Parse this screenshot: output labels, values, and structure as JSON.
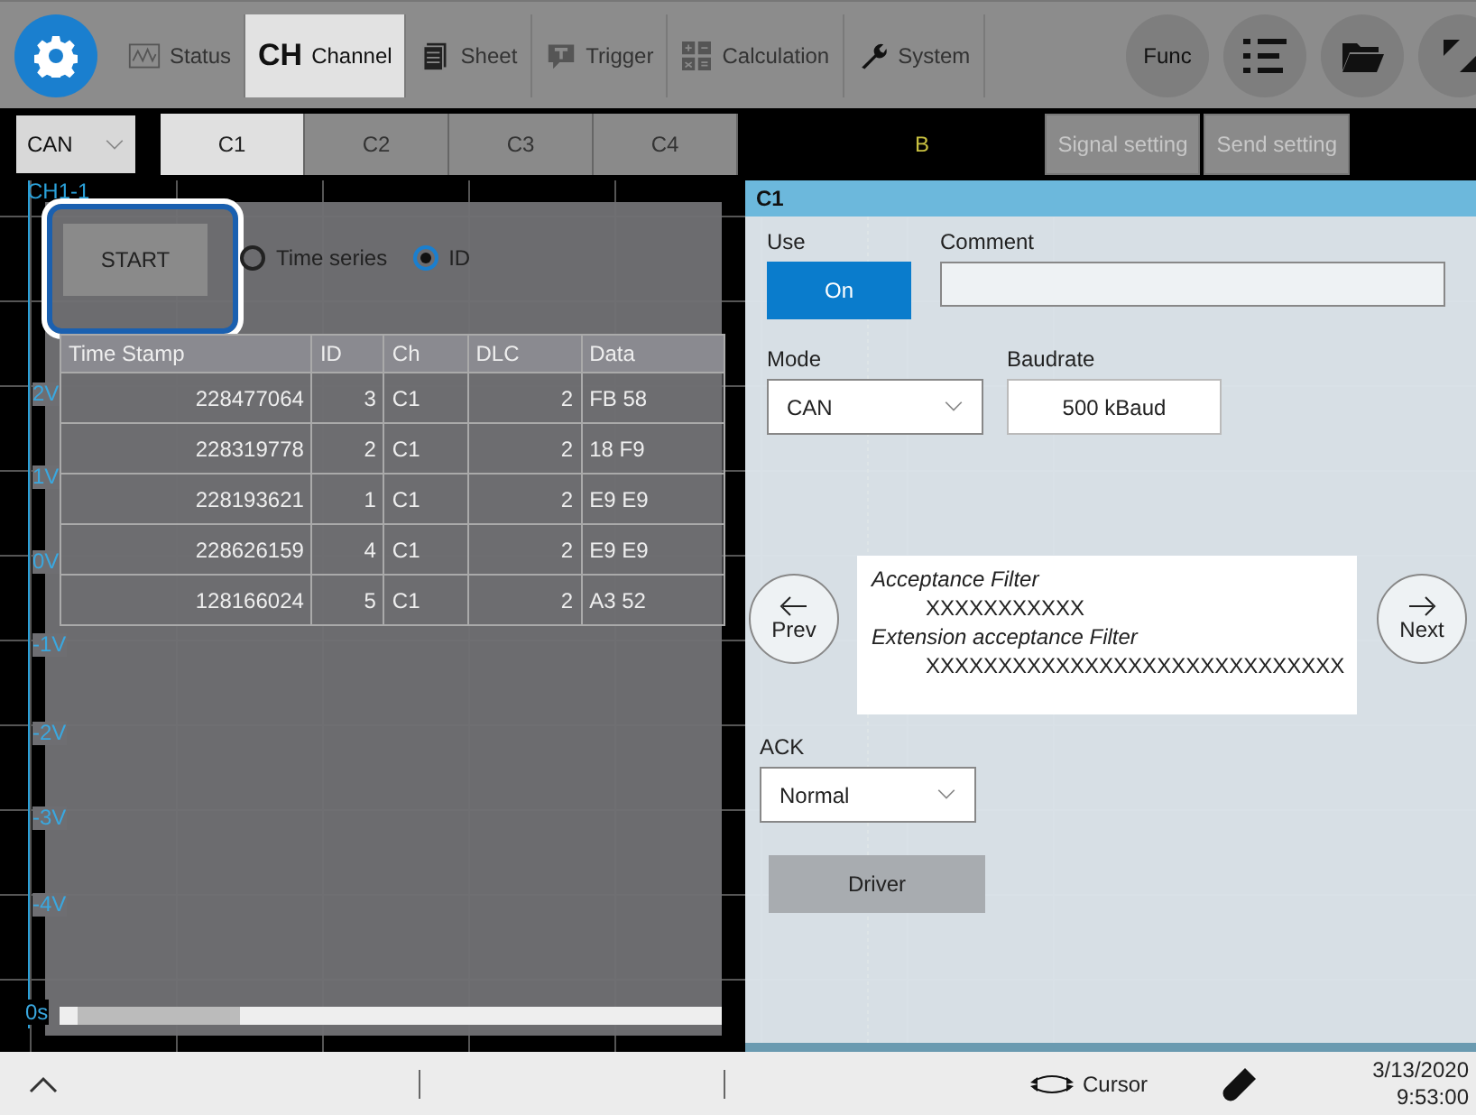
{
  "top_tabs": [
    {
      "label": "Status",
      "selected": false
    },
    {
      "label": "Channel",
      "selected": true
    },
    {
      "label": "Sheet",
      "selected": false
    },
    {
      "label": "Trigger",
      "selected": false
    },
    {
      "label": "Calculation",
      "selected": false
    },
    {
      "label": "System",
      "selected": false
    }
  ],
  "func_button": "Func",
  "ch_icon_text": "CH",
  "channel_bar": {
    "type_select": "CAN",
    "tabs": [
      {
        "label": "C1",
        "selected": true
      },
      {
        "label": "C2",
        "selected": false
      },
      {
        "label": "C3",
        "selected": false
      },
      {
        "label": "C4",
        "selected": false
      }
    ],
    "marker": "B",
    "buttons": [
      "Signal setting",
      "Send setting"
    ]
  },
  "graph": {
    "channel_label": "CH1-1",
    "y_labels": [
      "2V",
      "1V",
      "0V",
      "-1V",
      "-2V",
      "-3V",
      "-4V"
    ],
    "x_labels": [
      "0s"
    ]
  },
  "monitor": {
    "start_button": "START",
    "view_options": [
      {
        "label": "Time series",
        "selected": false
      },
      {
        "label": "ID",
        "selected": true
      }
    ],
    "columns": [
      "Time Stamp",
      "ID",
      "Ch",
      "DLC",
      "Data"
    ],
    "rows": [
      [
        "228477064",
        "3",
        "C1",
        "2",
        "FB 58"
      ],
      [
        "228319778",
        "2",
        "C1",
        "2",
        "18 F9"
      ],
      [
        "228193621",
        "1",
        "C1",
        "2",
        "E9 E9"
      ],
      [
        "228626159",
        "4",
        "C1",
        "2",
        "E9 E9"
      ],
      [
        "128166024",
        "5",
        "C1",
        "2",
        "A3 52"
      ]
    ]
  },
  "dialog": {
    "title": "C1",
    "use_label": "Use",
    "use_value": "On",
    "use_on": true,
    "comment_label": "Comment",
    "mode_label": "Mode",
    "mode_value": "CAN",
    "baudrate_label": "Baudrate",
    "baudrate_value": "500 kBaud",
    "prev": "Prev",
    "next": "Next",
    "filter": {
      "label": "Acceptance Filter",
      "value": "XXXXXXXXXXX",
      "ext_label": "Extension acceptance Filter",
      "ext_value": "XXXXXXXXXXXXXXXXXXXXXXXXXXXXX"
    },
    "ack_label": "ACK",
    "ack_value": "Normal",
    "driver_button": "Driver"
  },
  "status_bar": {
    "cursor_label": "Cursor",
    "date": "3/13/2020",
    "time": "9:53:00"
  }
}
